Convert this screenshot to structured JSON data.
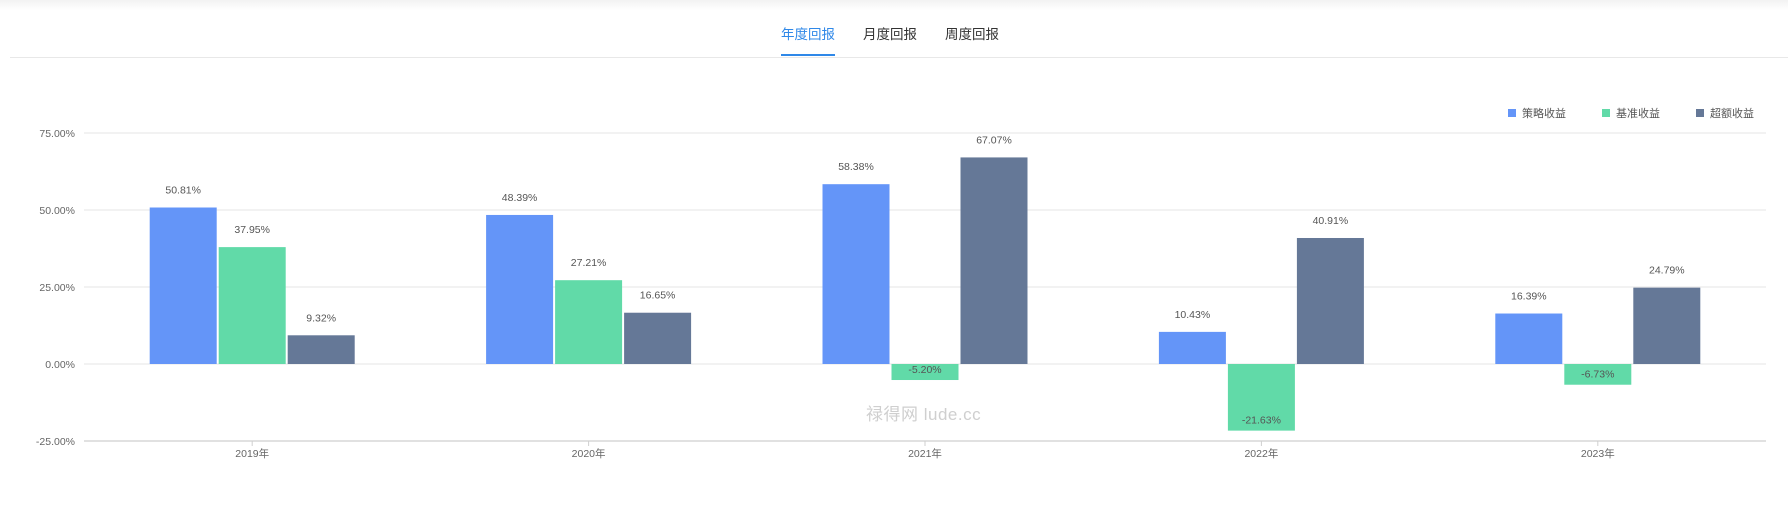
{
  "tabs": [
    {
      "label": "年度回报",
      "active": true
    },
    {
      "label": "月度回报",
      "active": false
    },
    {
      "label": "周度回报",
      "active": false
    }
  ],
  "watermark": "禄得网 lude.cc",
  "chart_data": {
    "type": "bar",
    "categories": [
      "2019年",
      "2020年",
      "2021年",
      "2022年",
      "2023年"
    ],
    "series": [
      {
        "name": "策略收益",
        "color": "#6495f8",
        "values": [
          50.81,
          48.39,
          58.38,
          10.43,
          16.39
        ]
      },
      {
        "name": "基准收益",
        "color": "#61daa8",
        "values": [
          37.95,
          27.21,
          -5.2,
          -21.63,
          -6.73
        ]
      },
      {
        "name": "超额收益",
        "color": "#657897",
        "values": [
          9.32,
          16.65,
          67.07,
          40.91,
          24.79
        ]
      }
    ],
    "value_labels": [
      [
        "50.81%",
        "48.39%",
        "58.38%",
        "10.43%",
        "16.39%"
      ],
      [
        "37.95%",
        "27.21%",
        "-5.20%",
        "-21.63%",
        "-6.73%"
      ],
      [
        "9.32%",
        "16.65%",
        "67.07%",
        "40.91%",
        "24.79%"
      ]
    ],
    "yticks": [
      75,
      50,
      25,
      0,
      -25
    ],
    "ytick_labels": [
      "75.00%",
      "50.00%",
      "25.00%",
      "0.00%",
      "-25.00%"
    ],
    "ylim": [
      -25,
      75
    ],
    "grid": true,
    "legend_position": "top-right"
  }
}
